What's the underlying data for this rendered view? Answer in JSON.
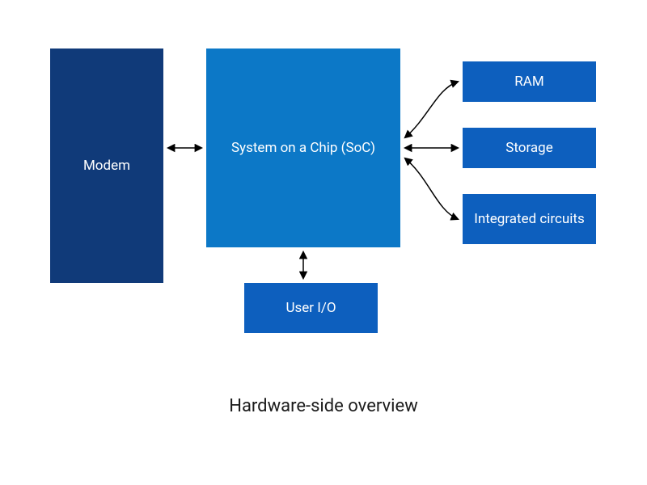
{
  "diagram": {
    "caption": "Hardware-side overview",
    "boxes": {
      "modem": "Modem",
      "soc": "System on a Chip (SoC)",
      "userio": "User I/O",
      "ram": "RAM",
      "storage": "Storage",
      "ic": "Integrated circuits"
    },
    "connections": [
      {
        "from": "modem",
        "to": "soc",
        "bidir": true
      },
      {
        "from": "soc",
        "to": "userio",
        "bidir": true
      },
      {
        "from": "soc",
        "to": "ram",
        "bidir": true
      },
      {
        "from": "soc",
        "to": "storage",
        "bidir": true
      },
      {
        "from": "soc",
        "to": "ic",
        "bidir": true
      }
    ]
  }
}
